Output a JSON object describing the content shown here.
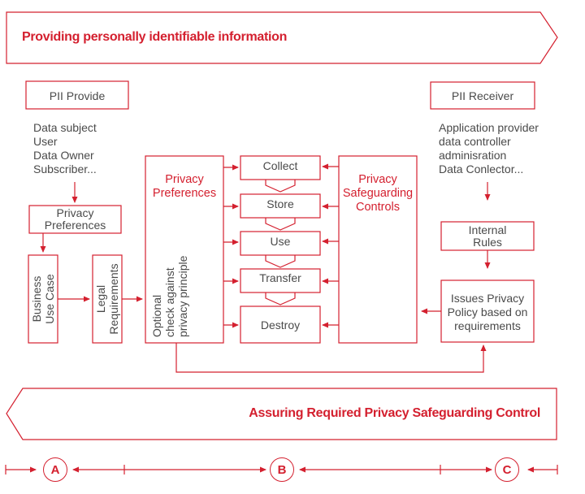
{
  "banners": {
    "top": "Providing personally identifiable information",
    "bottom": "Assuring Required Privacy Safeguarding Control"
  },
  "provider": {
    "title": "PII Provide",
    "roles": [
      "Data subject",
      "User",
      "Data Owner",
      "Subscriber..."
    ],
    "privacy_preferences": [
      "Privacy",
      "Preferences"
    ],
    "business_use_case": [
      "Business",
      "Use Case"
    ],
    "legal_requirements": [
      "Legal",
      "Requirements"
    ]
  },
  "center": {
    "privacy_preferences": [
      "Privacy",
      "Preferences"
    ],
    "optional_check": [
      "Optional",
      "check against",
      "privacy principle"
    ],
    "lifecycle": [
      "Collect",
      "Store",
      "Use",
      "Transfer",
      "Destroy"
    ],
    "safeguarding": [
      "Privacy",
      "Safeguarding",
      "Controls"
    ]
  },
  "receiver": {
    "title": "PII Receiver",
    "roles": [
      "Application provider",
      "data controller",
      "adminisration",
      "Data Conlector..."
    ],
    "internal_rules": [
      "Internal",
      "Rules"
    ],
    "issues_policy": [
      "Issues Privacy",
      "Policy based on",
      "requirements"
    ]
  },
  "phases": [
    "A",
    "B",
    "C"
  ],
  "colors": {
    "accent": "#d4202f",
    "text": "#4a4a4a"
  }
}
